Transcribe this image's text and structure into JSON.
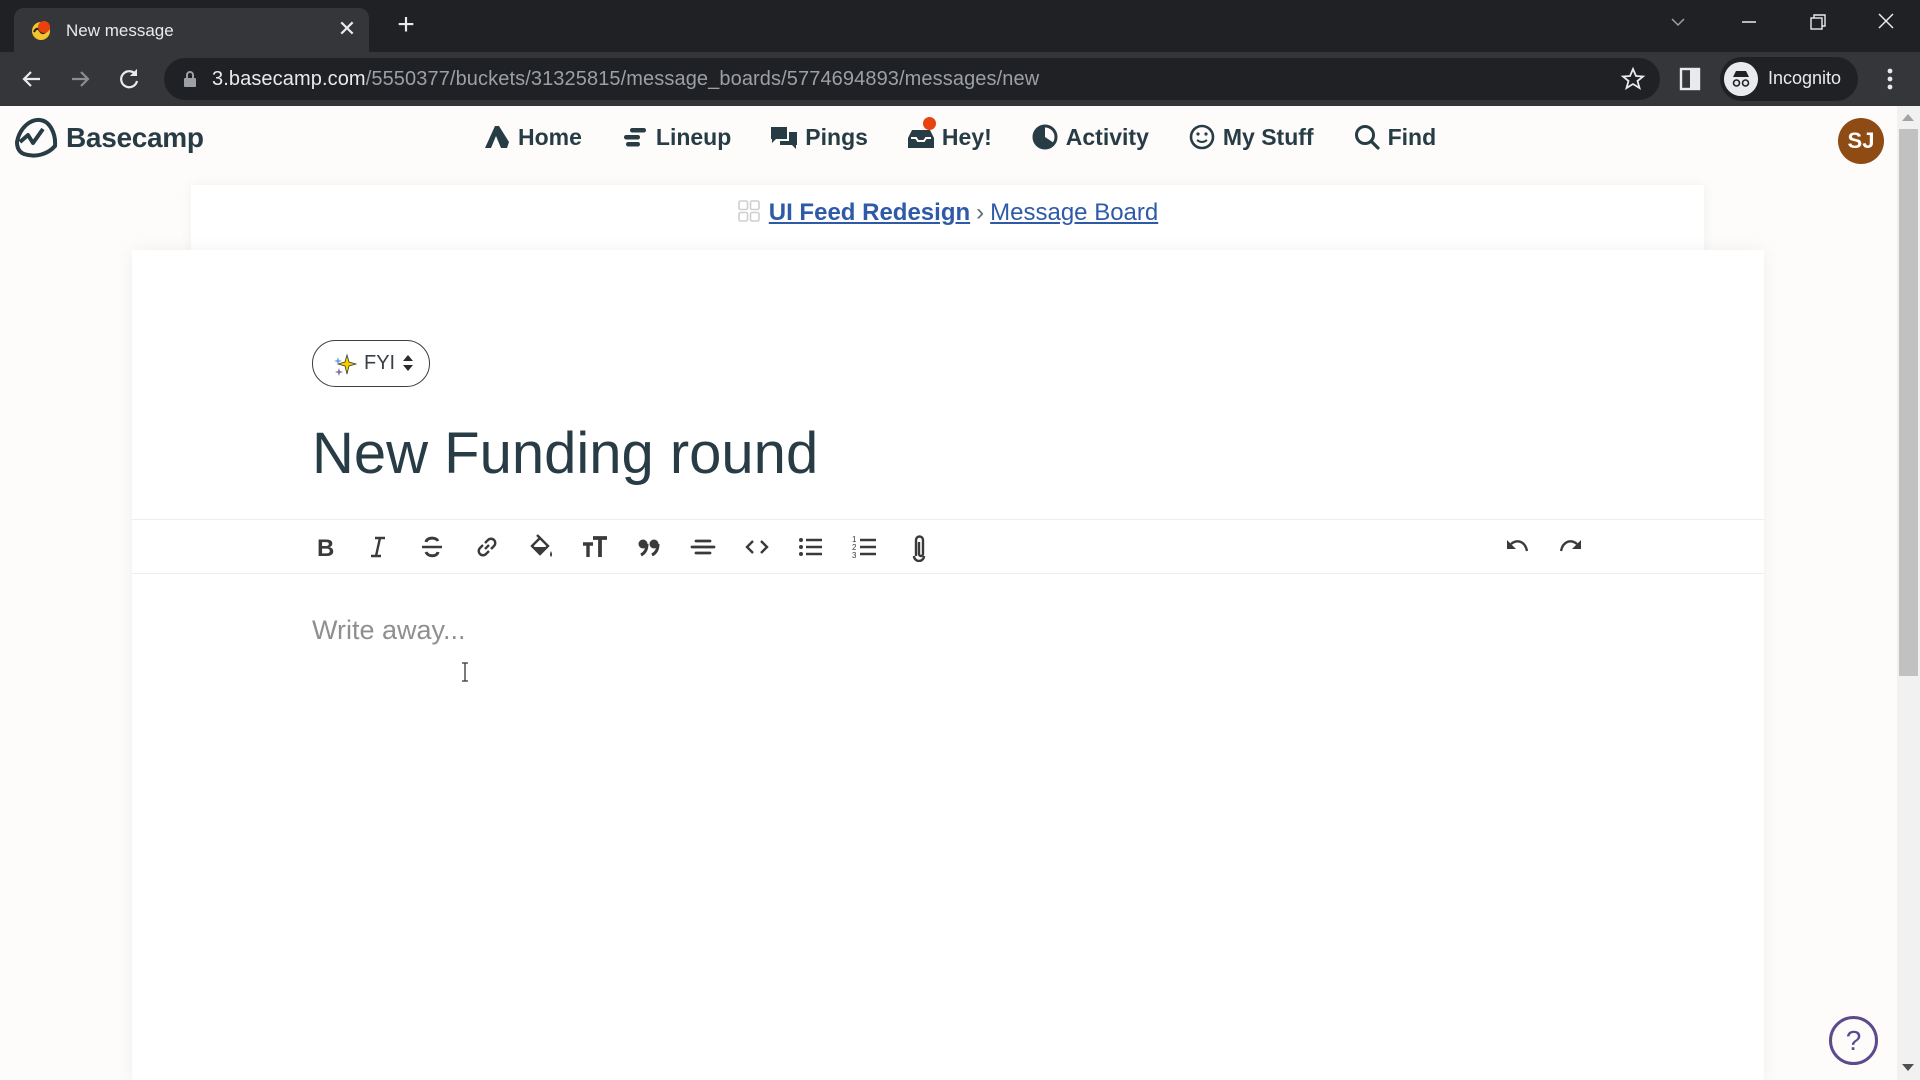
{
  "browser": {
    "tab": {
      "title": "New message",
      "close_icon": "close-icon"
    },
    "new_tab_icon": "plus-icon",
    "window_controls": [
      "tab-search-icon",
      "minimize-icon",
      "restore-icon",
      "close-icon"
    ],
    "address": {
      "host": "3.basecamp.com",
      "path": "/5550377/buckets/31325815/message_boards/5774694893/messages/new"
    },
    "profile_label": "Incognito"
  },
  "nav": {
    "brand": "Basecamp",
    "items": [
      {
        "label": "Home",
        "icon": "home-icon"
      },
      {
        "label": "Lineup",
        "icon": "lineup-icon"
      },
      {
        "label": "Pings",
        "icon": "pings-icon"
      },
      {
        "label": "Hey!",
        "icon": "hey-inbox-icon",
        "has_notification": true
      },
      {
        "label": "Activity",
        "icon": "activity-icon"
      },
      {
        "label": "My Stuff",
        "icon": "smiley-icon"
      },
      {
        "label": "Find",
        "icon": "search-icon"
      }
    ],
    "user_initials": "SJ",
    "user_avatar_color": "#8f4b14",
    "notification_color": "#e8430f"
  },
  "breadcrumb": {
    "project": "UI Feed Redesign",
    "separator": "›",
    "board": "Message Board"
  },
  "message": {
    "category": "FYI",
    "category_emoji": "sparkles-icon",
    "title": "New Funding round",
    "body_placeholder": "Write away..."
  },
  "editor_toolbar": {
    "tools": [
      "bold",
      "italic",
      "strikethrough",
      "link",
      "highlight-color",
      "heading",
      "quote",
      "horizontal-rule",
      "code",
      "bullet-list",
      "numbered-list",
      "attachment"
    ],
    "history": [
      "undo",
      "redo"
    ]
  },
  "help": {
    "label": "?"
  },
  "colors": {
    "link": "#2f5aa8",
    "text": "#283c46",
    "help": "#5b4a8c"
  }
}
